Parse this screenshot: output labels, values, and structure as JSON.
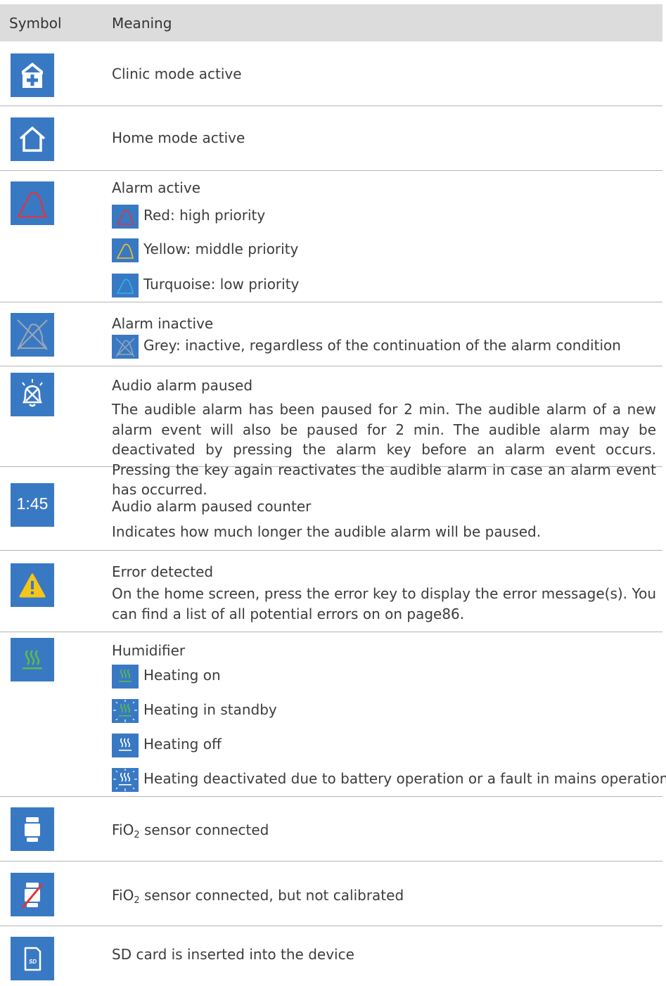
{
  "table": {
    "col_symbol": "Symbol",
    "col_meaning": "Meaning"
  },
  "rows": {
    "clinic": "Clinic mode active",
    "home": "Home mode active",
    "alarm_active": {
      "title": "Alarm active",
      "red": "Red: high priority",
      "yellow": "Yellow: middle priority",
      "turquoise": "Turquoise: low priority"
    },
    "alarm_inactive": {
      "title": "Alarm inactive",
      "grey": "Grey: inactive, regardless of the continuation of the alarm condition"
    },
    "audio_paused": {
      "title": "Audio alarm paused",
      "desc": "The audible alarm has been paused for 2 min. The audible alarm of a new alarm event will also be paused for 2 min. The audible alarm may be deactivated by pressing the alarm key before an alarm event occurs. Pressing the key again reactivates the audible alarm in case an alarm event has occurred."
    },
    "audio_counter": {
      "icon_text": "1:45",
      "title": "Audio alarm paused counter",
      "desc": "Indicates how much longer the audible alarm will be paused."
    },
    "error": {
      "title": "Error detected",
      "desc": "On the home screen, press the error key to display the error message(s). You can find a list of all potential errors on  on page86."
    },
    "humidifier": {
      "title": "Humidifier",
      "on": "Heating on",
      "standby": "Heating in standby",
      "off": "Heating off",
      "deactivated": "Heating deactivated due to battery operation or a fault in mains operation"
    },
    "fio2_connected": {
      "pre": "FiO",
      "sub": "2",
      "post": " sensor connected"
    },
    "fio2_not_cal": {
      "pre": "FiO",
      "sub": "2",
      "post": " sensor connected, but not calibrated"
    },
    "sd": {
      "icon_text": "SD",
      "text": "SD card is inserted into the device"
    }
  },
  "colors": {
    "icon_bg": "#3979c4",
    "header_bg": "#dcdcdc",
    "red": "#e3343a",
    "yellow": "#f5c518",
    "turquoise": "#27b6e6",
    "green": "#5dbb46",
    "grey": "#9aa6b4"
  }
}
